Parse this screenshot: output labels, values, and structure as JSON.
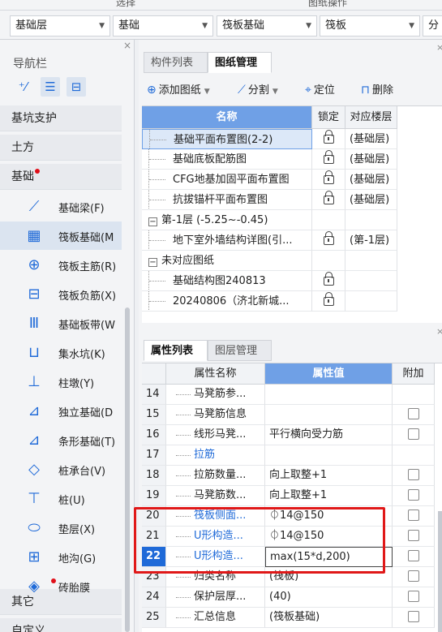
{
  "top_strip": {
    "left_text": "选择",
    "right_text": "图纸操作"
  },
  "toolbar": {
    "dropdowns": [
      "基础层",
      "基础",
      "筏板基础",
      "筏板",
      "分"
    ]
  },
  "nav": {
    "title": "导航栏",
    "tool_icons": [
      "pin-icon",
      "list-icon",
      "grid-view-icon"
    ],
    "sections": [
      {
        "label": "基坑支护"
      },
      {
        "label": "土方"
      },
      {
        "label": "基础",
        "has_dot": true
      },
      {
        "label": "其它"
      },
      {
        "label": "自定义"
      }
    ],
    "items": [
      {
        "label": "基础梁(F)",
        "icon": "beam-icon",
        "glyph": "⟋"
      },
      {
        "label": "筏板基础(M",
        "icon": "raft-foundation-icon",
        "glyph": "▦",
        "active": true
      },
      {
        "label": "筏板主筋(R)",
        "icon": "main-rebar-icon",
        "glyph": "⊕"
      },
      {
        "label": "筏板负筋(X)",
        "icon": "negative-rebar-icon",
        "glyph": "⊟"
      },
      {
        "label": "基础板带(W",
        "icon": "slab-strip-icon",
        "glyph": "Ⅲ"
      },
      {
        "label": "集水坑(K)",
        "icon": "sump-pit-icon",
        "glyph": "⊔"
      },
      {
        "label": "柱墩(Y)",
        "icon": "column-pier-icon",
        "glyph": "⊥"
      },
      {
        "label": "独立基础(D",
        "icon": "isolated-footing-icon",
        "glyph": "⊿"
      },
      {
        "label": "条形基础(T)",
        "icon": "strip-footing-icon",
        "glyph": "⊿"
      },
      {
        "label": "桩承台(V)",
        "icon": "pile-cap-icon",
        "glyph": "◇"
      },
      {
        "label": "桩(U)",
        "icon": "pile-icon",
        "glyph": "⊤"
      },
      {
        "label": "垫层(X)",
        "icon": "cushion-icon",
        "glyph": "⬭"
      },
      {
        "label": "地沟(G)",
        "icon": "trench-icon",
        "glyph": "⊞"
      },
      {
        "label": "砖胎膜",
        "icon": "brick-mold-icon",
        "glyph": "◈",
        "has_dot": true
      }
    ]
  },
  "drawing_panel": {
    "tabs": [
      "构件列表",
      "图纸管理"
    ],
    "active_tab": "图纸管理",
    "actions": [
      {
        "label": "添加图纸",
        "icon": "add-drawing-icon",
        "glyph": "⊕",
        "has_menu": true
      },
      {
        "label": "分割",
        "icon": "split-icon",
        "glyph": "⟋",
        "has_menu": true
      },
      {
        "label": "定位",
        "icon": "locate-icon",
        "glyph": "⌖",
        "has_menu": false
      },
      {
        "label": "删除",
        "icon": "delete-icon",
        "glyph": "🗑",
        "has_menu": false
      }
    ],
    "columns": {
      "name": "名称",
      "lock": "锁定",
      "floor": "对应楼层"
    },
    "rows": [
      {
        "kind": "item",
        "name": "基础平面布置图(2-2)",
        "floor": "(基础层)",
        "locked": true,
        "selected": true
      },
      {
        "kind": "item",
        "name": "基础底板配筋图",
        "floor": "(基础层)",
        "locked": true
      },
      {
        "kind": "item",
        "name": "CFG地基加固平面布置图",
        "floor": "(基础层)",
        "locked": true
      },
      {
        "kind": "item",
        "name": "抗拔锚杆平面布置图",
        "floor": "(基础层)",
        "locked": true
      },
      {
        "kind": "group",
        "name": "第-1层 (-5.25~-0.45)"
      },
      {
        "kind": "item",
        "name": "地下室外墙结构详图(引...",
        "floor": "(第-1层)",
        "locked": true
      },
      {
        "kind": "group",
        "name": "未对应图纸"
      },
      {
        "kind": "item",
        "name": "基础结构图240813",
        "floor": "",
        "locked": true
      },
      {
        "kind": "item",
        "name": "20240806（济北新城...",
        "floor": "",
        "locked": true
      }
    ]
  },
  "property_panel": {
    "tabs": [
      "属性列表",
      "图层管理"
    ],
    "active_tab": "属性列表",
    "columns": {
      "name": "属性名称",
      "value": "属性值",
      "extra": "附加"
    },
    "rows": [
      {
        "n": "14",
        "name": "马凳筋参...",
        "value": "",
        "check": false,
        "blue": false
      },
      {
        "n": "15",
        "name": "马凳筋信息",
        "value": "",
        "check": true,
        "blue": false
      },
      {
        "n": "16",
        "name": "线形马凳...",
        "value": "平行横向受力筋",
        "check": true,
        "blue": false
      },
      {
        "n": "17",
        "name": "拉筋",
        "value": "",
        "check": false,
        "blue": true
      },
      {
        "n": "18",
        "name": "拉筋数量...",
        "value": "向上取整+1",
        "check": true,
        "blue": false
      },
      {
        "n": "19",
        "name": "马凳筋数...",
        "value": "向上取整+1",
        "check": true,
        "blue": false
      },
      {
        "n": "20",
        "name": "筏板侧面...",
        "value": "⏀14@150",
        "check": true,
        "blue": true
      },
      {
        "n": "21",
        "name": "U形构造...",
        "value": "⏀14@150",
        "check": true,
        "blue": true
      },
      {
        "n": "22",
        "name": "U形构造...",
        "value": "max(15*d,200)",
        "check": true,
        "blue": true,
        "current": true
      },
      {
        "n": "23",
        "name": "归类名称",
        "value": "(筏板)",
        "check": true,
        "blue": false
      },
      {
        "n": "24",
        "name": "保护层厚...",
        "value": "(40)",
        "check": true,
        "blue": false
      },
      {
        "n": "25",
        "name": "汇总信息",
        "value": "(筏板基础)",
        "check": true,
        "blue": false
      }
    ]
  },
  "colors": {
    "accent": "#1f6ad8",
    "header_blue": "#6fa0e6",
    "highlight_red": "#e01818"
  }
}
